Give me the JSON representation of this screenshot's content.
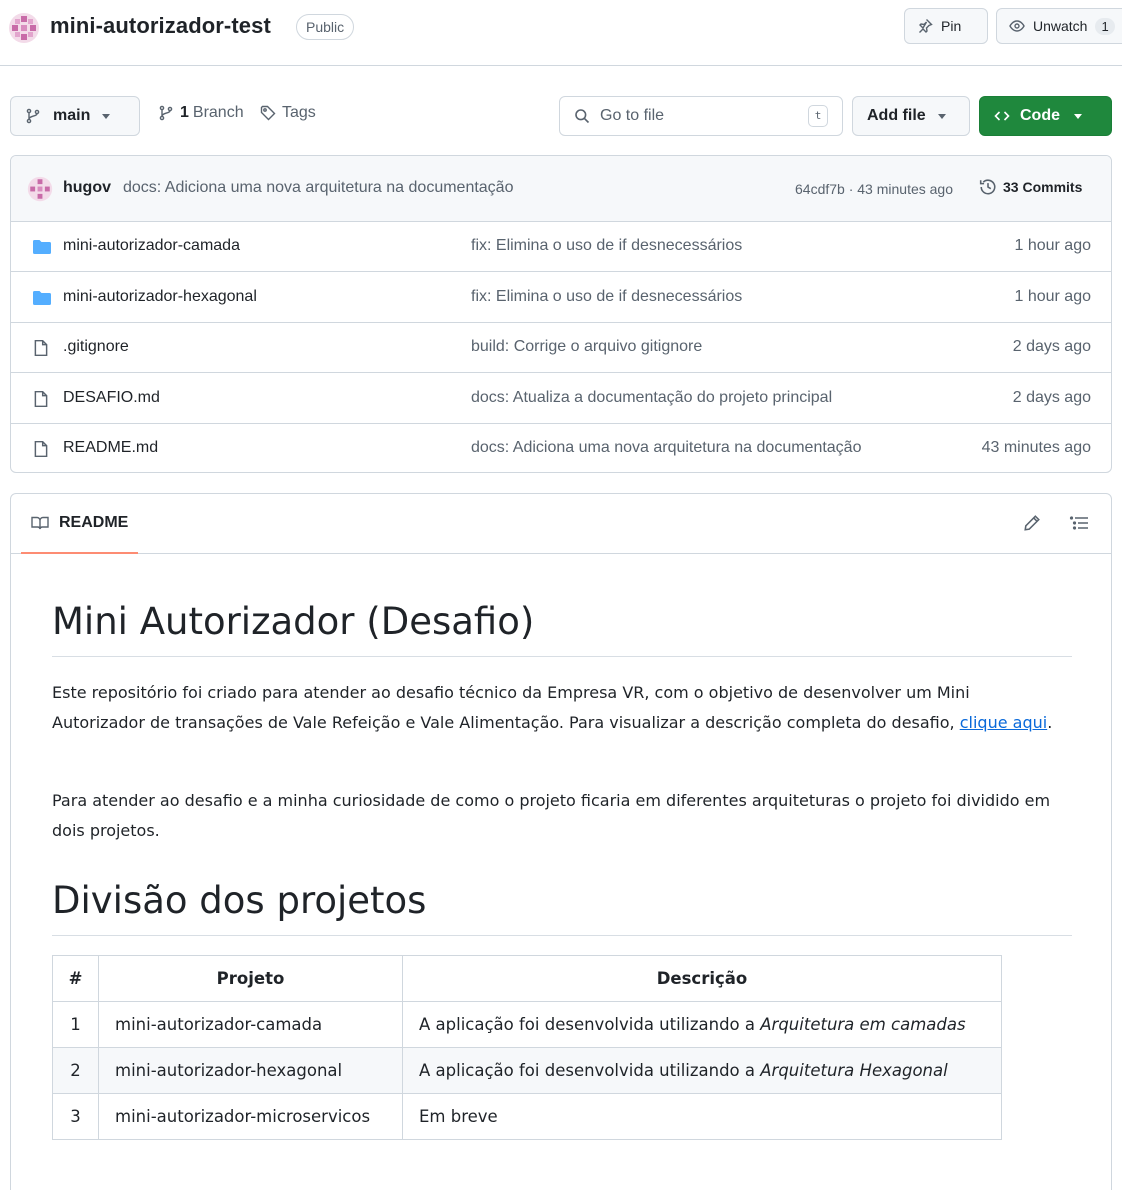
{
  "header": {
    "repo_name": "mini-autorizador-test",
    "visibility": "Public",
    "pin_label": "Pin",
    "unwatch_label": "Unwatch",
    "watch_count": "1"
  },
  "toolbar": {
    "branch": "main",
    "branches_count": "1",
    "branches_label": "Branch",
    "tags_label": "Tags",
    "search_placeholder": "Go to file",
    "search_shortcut": "t",
    "add_file_label": "Add file",
    "code_label": "Code"
  },
  "latest_commit": {
    "author": "hugov",
    "message": "docs: Adiciona uma nova arquitetura na documentação",
    "hash_time": "64cdf7b · 43 minutes ago",
    "commits_count": "33 Commits"
  },
  "files": [
    {
      "type": "folder",
      "name": "mini-autorizador-camada",
      "message": "fix: Elimina o uso de if desnecessários",
      "time": "1 hour ago"
    },
    {
      "type": "folder",
      "name": "mini-autorizador-hexagonal",
      "message": "fix: Elimina o uso de if desnecessários",
      "time": "1 hour ago"
    },
    {
      "type": "file",
      "name": ".gitignore",
      "message": "build: Corrige o arquivo gitignore",
      "time": "2 days ago"
    },
    {
      "type": "file",
      "name": "DESAFIO.md",
      "message": "docs: Atualiza a documentação do projeto principal",
      "time": "2 days ago"
    },
    {
      "type": "file",
      "name": "README.md",
      "message": "docs: Adiciona uma nova arquitetura na documentação",
      "time": "43 minutes ago"
    }
  ],
  "readme": {
    "tab_label": "README",
    "title": "Mini Autorizador (Desafio)",
    "intro_text": "Este repositório foi criado para atender ao desafio técnico da Empresa VR, com o objetivo de desenvolver um Mini Autorizador de transações de Vale Refeição e Vale Alimentação. Para visualizar a descrição completa do desafio, ",
    "intro_link": "clique aqui",
    "intro_end": ".",
    "paragraph2": "Para atender ao desafio e a minha curiosidade de como o projeto ficaria em diferentes arquiteturas o projeto foi dividido em dois projetos.",
    "section_title": "Divisão dos projetos",
    "table": {
      "headers": [
        "#",
        "Projeto",
        "Descrição"
      ],
      "desc_prefix": "A aplicação foi desenvolvida utilizando a ",
      "rows": [
        {
          "num": "1",
          "projeto": "mini-autorizador-camada",
          "desc_prefix": "A aplicação foi desenvolvida utilizando a ",
          "desc_em": "Arquitetura em camadas"
        },
        {
          "num": "2",
          "projeto": "mini-autorizador-hexagonal",
          "desc_prefix": "A aplicação foi desenvolvida utilizando a ",
          "desc_em": "Arquitetura Hexagonal"
        },
        {
          "num": "3",
          "projeto": "mini-autorizador-microservicos",
          "desc_prefix": "Em breve",
          "desc_em": ""
        }
      ]
    }
  },
  "colors": {
    "accent_green": "#1f883d",
    "folder_blue": "#54aeff",
    "link_blue": "#0969da",
    "tab_underline": "#fd8c73"
  },
  "icons": [
    "repo-avatar-icon",
    "pin-icon",
    "eye-icon",
    "branch-icon",
    "tag-icon",
    "search-icon",
    "code-icon",
    "history-icon",
    "folder-icon",
    "file-icon",
    "book-icon",
    "pencil-icon",
    "list-icon"
  ]
}
